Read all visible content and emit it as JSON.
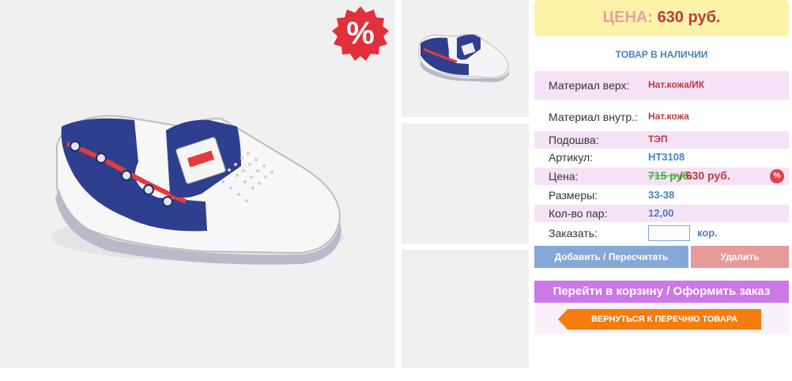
{
  "sale_badge": "%",
  "panel": {
    "price_label": "ЦЕНА:",
    "price_value": "630 руб.",
    "stock": "ТОВАР В НАЛИЧИИ",
    "specs": {
      "material_top_label": "Материал верх:",
      "material_top_value": "Нат.кожа/ИК",
      "material_inner_label": "Материал внутр.:",
      "material_inner_value": "Нат.кожа",
      "sole_label": "Подошва:",
      "sole_value": "ТЭП",
      "article_label": "Артикул:",
      "article_value": "НТ3108",
      "price_label": "Цена:",
      "old_price": "715 руб.",
      "new_price": " / 630 руб.",
      "price_badge": "%",
      "sizes_label": "Размеры:",
      "sizes_value": "33-38",
      "pairs_label": "Кол-во пар:",
      "pairs_value": "12,00",
      "order_label": "Заказать:",
      "order_input_value": "",
      "order_unit": "кор."
    },
    "buttons": {
      "add": "Добавить / Пересчитать",
      "delete": "Удалить",
      "cart": "Перейти в корзину / Оформить заказ",
      "back": "ВЕРНУТЬСЯ К ПЕРЕЧНЮ ТОВАРА"
    }
  },
  "colors": {
    "price_bg": "#fdf3a8",
    "price_text": "#c0393b",
    "link_blue": "#4a7fc1",
    "row_pink": "#f5e2f7",
    "add_button": "#86a8d6",
    "delete_button": "#e69a9a",
    "cart_button": "#cc78e6",
    "back_button": "#f57c0d",
    "old_price": "#3ab53a"
  }
}
